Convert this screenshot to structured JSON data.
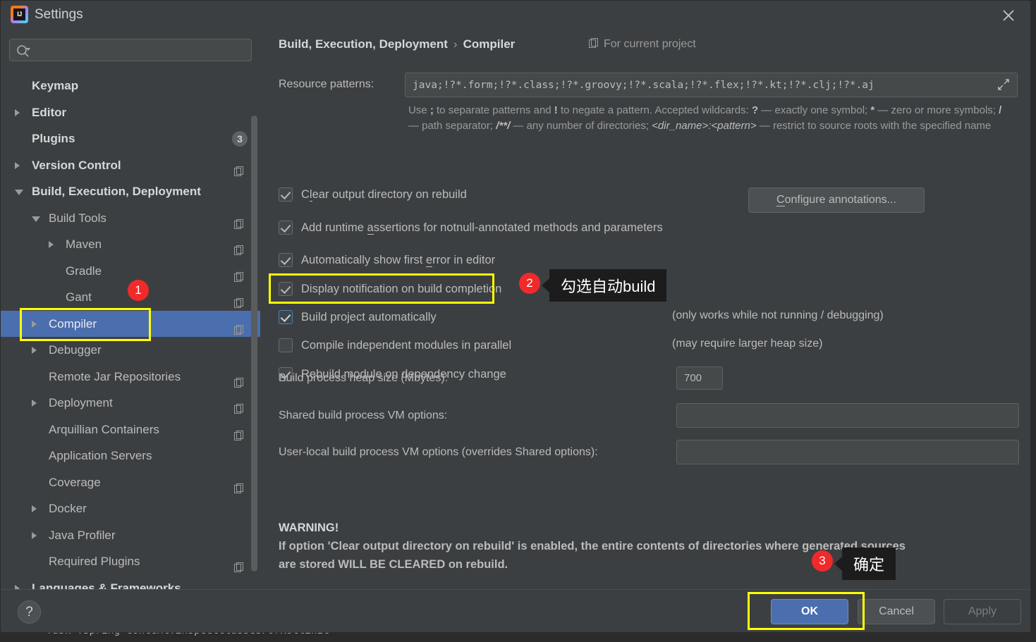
{
  "window": {
    "title": "Settings",
    "app_icon": "intellij-idea-logo",
    "close_icon": "close-icon"
  },
  "sidebar": {
    "search": {
      "placeholder": "",
      "value": "",
      "icon": "search-icon"
    },
    "items": [
      {
        "label": "Keymap",
        "indent": 44,
        "arrow": "none",
        "bold": true,
        "copy": false,
        "badge": null,
        "selected": false
      },
      {
        "label": "Editor",
        "indent": 44,
        "arrow": "right",
        "bold": true,
        "copy": false,
        "badge": null,
        "selected": false
      },
      {
        "label": "Plugins",
        "indent": 44,
        "arrow": "none",
        "bold": true,
        "copy": false,
        "badge": "3",
        "selected": false
      },
      {
        "label": "Version Control",
        "indent": 44,
        "arrow": "right",
        "bold": true,
        "copy": true,
        "badge": null,
        "selected": false
      },
      {
        "label": "Build, Execution, Deployment",
        "indent": 44,
        "arrow": "down",
        "bold": true,
        "copy": false,
        "badge": null,
        "selected": false
      },
      {
        "label": "Build Tools",
        "indent": 68,
        "arrow": "down",
        "bold": false,
        "copy": true,
        "badge": null,
        "selected": false
      },
      {
        "label": "Maven",
        "indent": 92,
        "arrow": "right",
        "bold": false,
        "copy": true,
        "badge": null,
        "selected": false
      },
      {
        "label": "Gradle",
        "indent": 92,
        "arrow": "none",
        "bold": false,
        "copy": true,
        "badge": null,
        "selected": false
      },
      {
        "label": "Gant",
        "indent": 92,
        "arrow": "none",
        "bold": false,
        "copy": true,
        "badge": null,
        "selected": false
      },
      {
        "label": "Compiler",
        "indent": 68,
        "arrow": "right",
        "bold": false,
        "copy": true,
        "badge": null,
        "selected": true
      },
      {
        "label": "Debugger",
        "indent": 68,
        "arrow": "right",
        "bold": false,
        "copy": false,
        "badge": null,
        "selected": false
      },
      {
        "label": "Remote Jar Repositories",
        "indent": 68,
        "arrow": "none",
        "bold": false,
        "copy": true,
        "badge": null,
        "selected": false
      },
      {
        "label": "Deployment",
        "indent": 68,
        "arrow": "right",
        "bold": false,
        "copy": true,
        "badge": null,
        "selected": false
      },
      {
        "label": "Arquillian Containers",
        "indent": 68,
        "arrow": "none",
        "bold": false,
        "copy": true,
        "badge": null,
        "selected": false
      },
      {
        "label": "Application Servers",
        "indent": 68,
        "arrow": "none",
        "bold": false,
        "copy": false,
        "badge": null,
        "selected": false
      },
      {
        "label": "Coverage",
        "indent": 68,
        "arrow": "none",
        "bold": false,
        "copy": true,
        "badge": null,
        "selected": false
      },
      {
        "label": "Docker",
        "indent": 68,
        "arrow": "right",
        "bold": false,
        "copy": false,
        "badge": null,
        "selected": false
      },
      {
        "label": "Java Profiler",
        "indent": 68,
        "arrow": "right",
        "bold": false,
        "copy": false,
        "badge": null,
        "selected": false
      },
      {
        "label": "Required Plugins",
        "indent": 68,
        "arrow": "none",
        "bold": false,
        "copy": true,
        "badge": null,
        "selected": false
      },
      {
        "label": "Languages & Frameworks",
        "indent": 44,
        "arrow": "right",
        "bold": true,
        "copy": false,
        "badge": null,
        "selected": false
      }
    ]
  },
  "main": {
    "breadcrumb_root": "Build, Execution, Deployment",
    "breadcrumb_sep": "›",
    "breadcrumb_leaf": "Compiler",
    "scope_label": "For current project",
    "scope_icon": "copy-icon",
    "resource_patterns": {
      "label": "Resource patterns:",
      "value": "java;!?*.form;!?*.class;!?*.groovy;!?*.scala;!?*.flex;!?*.kt;!?*.clj;!?*.aj",
      "expand_icon": "expand-icon"
    },
    "hint_line1_a": "Use ",
    "hint_line1_semi": ";",
    "hint_line1_b": " to separate patterns and ",
    "hint_line1_bang": "!",
    "hint_line1_c": " to negate a pattern. Accepted wildcards: ",
    "hint_q": "?",
    "hint_line1_d": " — exactly one symbol; ",
    "hint_star": "*",
    "hint_line1_e": " — zero or",
    "hint_line2_a": "more symbols; ",
    "hint_slash": "/",
    "hint_line2_b": " — path separator; ",
    "hint_globstar": "/**/",
    "hint_line2_c": " — any number of directories; ",
    "hint_dirname": "<dir_name>:<pattern>",
    "hint_line2_d": " — restrict to",
    "hint_line3": "source roots with the specified name",
    "checkboxes": [
      {
        "label_pre": "C",
        "label_u": "l",
        "label_post": "ear output directory on rebuild",
        "checked": true,
        "focused": false,
        "note": ""
      },
      {
        "label_pre": "Add runtime ",
        "label_u": "a",
        "label_post": "ssertions for notnull-annotated methods and parameters",
        "checked": true,
        "focused": false,
        "note": ""
      },
      {
        "label_pre": "Automatically show first ",
        "label_u": "e",
        "label_post": "rror in editor",
        "checked": true,
        "focused": false,
        "note": ""
      },
      {
        "label_pre": "Display notification on build completion",
        "label_u": "",
        "label_post": "",
        "checked": true,
        "focused": false,
        "note": ""
      },
      {
        "label_pre": "Build project automatically",
        "label_u": "",
        "label_post": "",
        "checked": true,
        "focused": true,
        "note": "(only works while not running / debugging)"
      },
      {
        "label_pre": "Compile independent modules in parallel",
        "label_u": "",
        "label_post": "",
        "checked": false,
        "focused": false,
        "note": "(may require larger heap size)"
      },
      {
        "label_pre": "Rebuild module on dependency change",
        "label_u": "",
        "label_post": "",
        "checked": true,
        "focused": false,
        "note": ""
      }
    ],
    "configure_annotations": {
      "pre": "",
      "u": "C",
      "post": "onfigure annotations..."
    },
    "heap_label": "Build process heap size (Mbytes):",
    "heap_value": "700",
    "shared_vm_label": "Shared build process VM options:",
    "shared_vm_value": "",
    "userlocal_vm_label": "User-local build process VM options (overrides Shared options):",
    "userlocal_vm_value": "",
    "warning_title": "WARNING!",
    "warning_line1": "If option 'Clear output directory on rebuild' is enabled, the entire contents of directories where generated sources",
    "warning_line2": "are stored WILL BE CLEARED on rebuild."
  },
  "footer": {
    "help_label": "?",
    "ok_label": "OK",
    "cancel_label": "Cancel",
    "apply_label": "Apply"
  },
  "annotations": [
    {
      "id": "1",
      "text": null
    },
    {
      "id": "2",
      "text": "勾选自动build"
    },
    {
      "id": "3",
      "text": "确定"
    }
  ],
  "background": {
    "console_line": "> Task :spring-context:inspectClassesForKotlinIC"
  },
  "colors": {
    "dialog_bg": "#3c3f41",
    "selection_blue": "#4b6eaf",
    "highlight_yellow": "#ffff00",
    "badge_red": "#f02a2a",
    "tooltip_bg": "#1c1c1c",
    "text_primary": "#bbbbbb",
    "text_muted": "#9a9a9a"
  }
}
